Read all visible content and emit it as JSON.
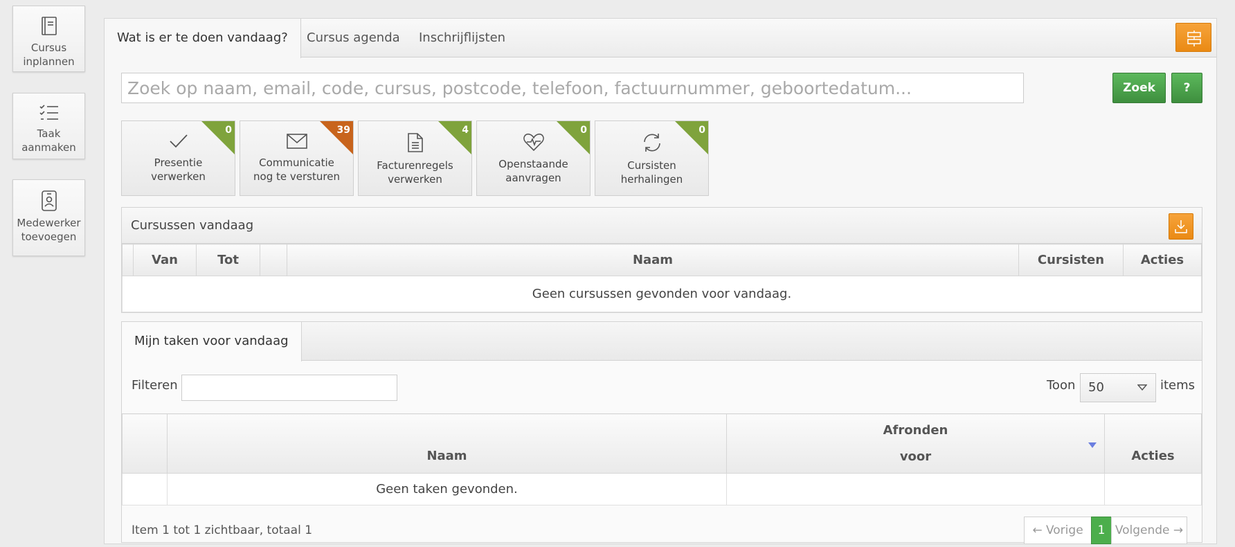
{
  "sidebar": {
    "buttons": [
      {
        "label": "Cursus\ninplannen",
        "icon": "book-icon"
      },
      {
        "label": "Taak\naanmaken",
        "icon": "task-list-icon"
      },
      {
        "label": "Medewerker\ntoevoegen",
        "icon": "id-badge-icon"
      }
    ]
  },
  "tabs": [
    {
      "label": "Wat is er te doen vandaag?",
      "active": true
    },
    {
      "label": "Cursus agenda",
      "active": false
    },
    {
      "label": "Inschrijflijsten",
      "active": false
    }
  ],
  "search": {
    "placeholder": "Zoek op naam, email, code, cursus, postcode, telefoon, factuurnummer, geboortedatum...",
    "button_label": "Zoek",
    "help_label": "?"
  },
  "tiles": [
    {
      "label": "Presentie\nverwerken",
      "count": "0",
      "icon": "check-icon",
      "badge_color": "#7fa33c"
    },
    {
      "label": "Communicatie\nnog te versturen",
      "count": "39",
      "icon": "envelope-icon",
      "badge_color": "#c8641c"
    },
    {
      "label": "Facturenregels\nverwerken",
      "count": "4",
      "icon": "document-icon",
      "badge_color": "#7fa33c"
    },
    {
      "label": "Openstaande\naanvragen",
      "count": "0",
      "icon": "heartbeat-icon",
      "badge_color": "#7fa33c"
    },
    {
      "label": "Cursisten\nherhalingen",
      "count": "0",
      "icon": "refresh-icon",
      "badge_color": "#7fa33c"
    }
  ],
  "courses_today": {
    "title": "Cursussen vandaag",
    "columns": [
      "Van",
      "Tot",
      "",
      "Naam",
      "Cursisten",
      "Acties"
    ],
    "empty_message": "Geen cursussen gevonden voor vandaag."
  },
  "tasks": {
    "tab_label": "Mijn taken voor vandaag",
    "filter_label": "Filteren",
    "filter_value": "",
    "show_label": "Toon",
    "show_value": "50",
    "items_label": "items",
    "columns": {
      "naam": "Naam",
      "afronden_line1": "Afronden",
      "afronden_line2": "voor",
      "acties": "Acties"
    },
    "empty_message": "Geen taken gevonden.",
    "footer_text": "Item 1 tot 1 zichtbaar, totaal 1",
    "pager": {
      "prev": "← Vorige",
      "current": "1",
      "next": "Volgende →"
    }
  },
  "colors": {
    "accent_orange": "#ef9420",
    "accent_green": "#4cae4c",
    "badge_green": "#7fa33c",
    "badge_orange": "#c8641c"
  }
}
